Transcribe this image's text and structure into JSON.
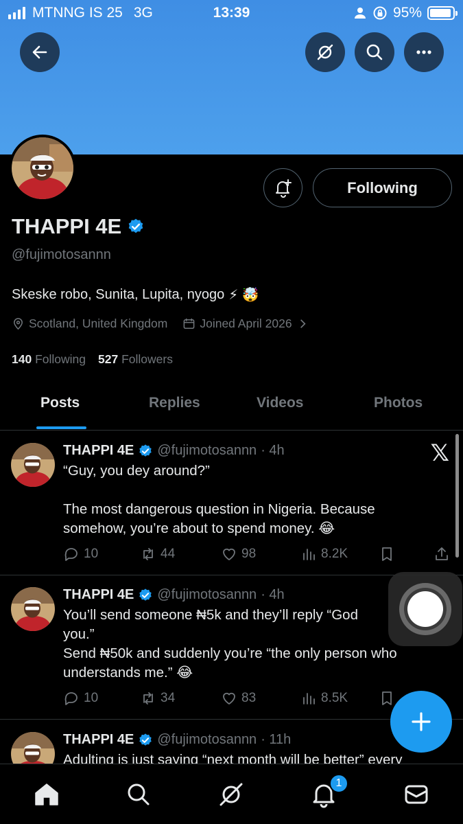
{
  "status_bar": {
    "carrier": "MTNNG IS 25",
    "network": "3G",
    "time": "13:39",
    "battery_pct": "95%",
    "battery_level": 0.95
  },
  "header": {
    "back_icon": "arrow-left-icon",
    "grok_icon": "grok-icon",
    "search_icon": "search-icon",
    "more_icon": "more-icon"
  },
  "profile": {
    "name": "THAPPI 4E",
    "handle": "@fujimotosannn",
    "bio": "Skeske robo, Sunita, Lupita, nyogo",
    "bio_emojis": "⚡ 🤯",
    "location": "Scotland, United Kingdom",
    "joined": "Joined April 2026",
    "following_count": "140",
    "following_label": "Following",
    "followers_count": "527",
    "followers_label": "Followers",
    "follow_button": "Following"
  },
  "tabs": [
    {
      "label": "Posts",
      "active": true
    },
    {
      "label": "Replies",
      "active": false
    },
    {
      "label": "Videos",
      "active": false
    },
    {
      "label": "Photos",
      "active": false
    }
  ],
  "posts": [
    {
      "name": "THAPPI 4E",
      "handle": "@fujimotosannn",
      "time": "· 4h",
      "text": [
        "“Guy, you dey around?”",
        "",
        "The most dangerous question in Nigeria. Because",
        "somehow, you’re about to spend money. 😂"
      ],
      "replies": "10",
      "reposts": "44",
      "likes": "98",
      "views": "8.2K"
    },
    {
      "name": "THAPPI 4E",
      "handle": "@fujimotosannn",
      "time": "· 4h",
      "text": [
        "You’ll send someone ₦5k and they’ll reply “God",
        "you.”",
        "Send ₦50k and suddenly you’re “the only person who",
        "understands me.” 😂"
      ],
      "replies": "10",
      "reposts": "34",
      "likes": "83",
      "views": "8.5K"
    },
    {
      "name": "THAPPI 4E",
      "handle": "@fujimotosannn",
      "time": "· 11h",
      "text": [
        "Adulting is just saying “next month will be better” every"
      ]
    }
  ],
  "nav": {
    "notifications_badge": "1"
  },
  "colors": {
    "accent": "#1d9bf0",
    "banner": "#4a9ae8",
    "background": "#000000",
    "muted": "#71767b"
  }
}
